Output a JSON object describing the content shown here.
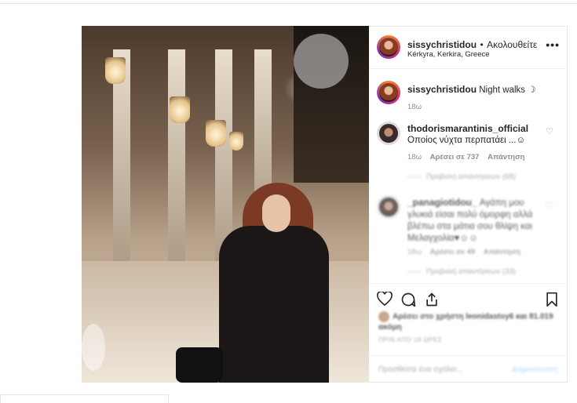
{
  "post": {
    "username": "sissychristidou",
    "separator": "•",
    "follow_label": "Ακολουθείτε",
    "location": "Kérkyra, Kerkira, Greece",
    "more_label": "•••"
  },
  "caption": {
    "username": "sissychristidou",
    "text": "Night walks ☽",
    "time": "18ω"
  },
  "comments": [
    {
      "username": "thodorismarantinis_official",
      "text": "Οποίος νύχτα περπατάει ...☺",
      "time": "18ω",
      "likes": "Αρέσει σε 737",
      "reply": "Απάντηση",
      "view_replies": "Προβολή απαντήσεων (68)"
    },
    {
      "username": "_panagiotidou_",
      "text": "Αγάπη μου γλυκιά είσαι πολύ όμορφη αλλά βλέπω στα μάτια σου θλίψη και Μελαγχολία♥☺☺",
      "time": "18ω",
      "likes": "Αρέσει σε 49",
      "reply": "Απάντηση",
      "view_replies": "Προβολή απαντήσεων (33)"
    }
  ],
  "liked_by": {
    "text": "Αρέσει στο χρήστη leonidastoy6 και 81.019 ακόμη"
  },
  "time_ago": "ΠΡΙΝ ΑΠΟ 18 ΩΡΕΣ",
  "add_comment": {
    "placeholder": "Προσθέστε ένα σχόλιο...",
    "post_label": "Δημοσίευση"
  },
  "icons": {
    "heart": "heart-icon",
    "comment": "comment-icon",
    "share": "share-icon",
    "bookmark": "bookmark-icon"
  }
}
